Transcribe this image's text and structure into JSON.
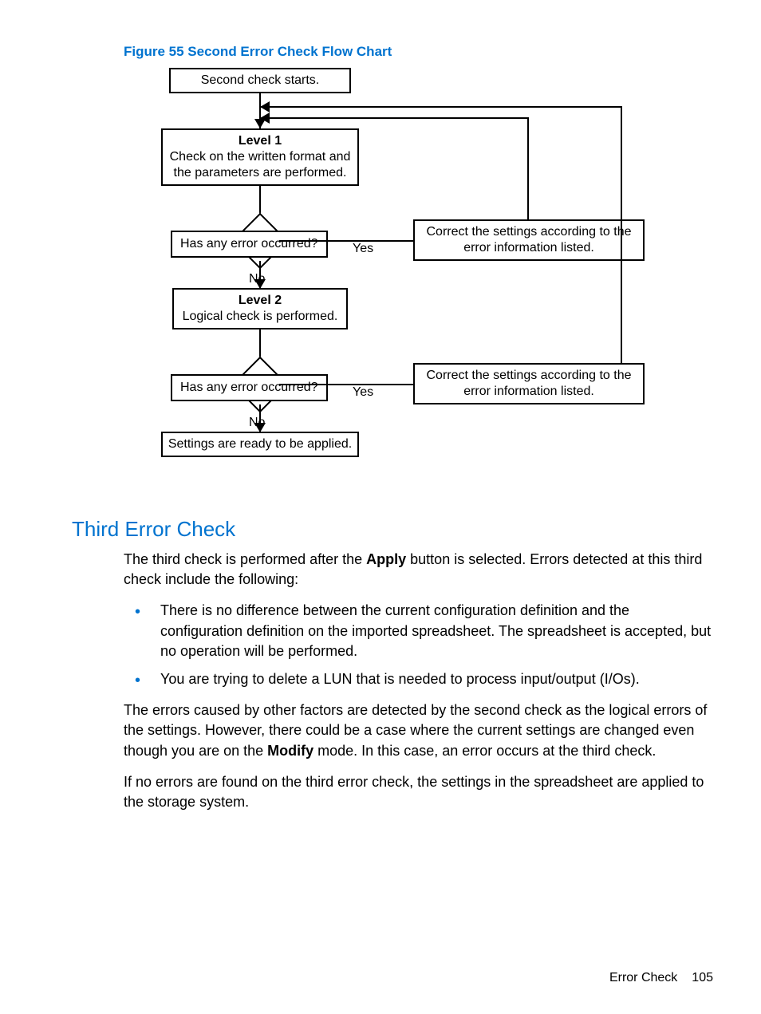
{
  "caption": "Figure 55 Second Error Check Flow Chart",
  "flow": {
    "start": "Second check starts.",
    "level1_title": "Level 1",
    "level1_text": "Check on the written format and the parameters are performed.",
    "decision1": "Has any error occurred?",
    "correct1": "Correct the settings according to the error information listed.",
    "yes": "Yes",
    "no": "No",
    "level2_title": "Level 2",
    "level2_text": "Logical check is performed.",
    "decision2": "Has any error occurred?",
    "correct2": "Correct the settings according to the error information listed.",
    "final": "Settings are ready to be applied."
  },
  "heading": "Third Error Check",
  "para1_a": "The third check is performed after the ",
  "para1_bold": "Apply",
  "para1_b": " button is selected. Errors detected at this third check include the following:",
  "bullets": [
    "There is no difference between the current configuration definition and the configuration definition on the imported spreadsheet. The spreadsheet is accepted, but no operation will be performed.",
    "You are trying to delete a LUN that is needed to process input/output (I/Os)."
  ],
  "para2_a": "The errors caused by other factors are detected by the second check as the logical errors of the settings. However, there could be a case where the current settings are changed even though you are on the ",
  "para2_bold": "Modify",
  "para2_b": " mode. In this case, an error occurs at the third check.",
  "para3": "If no errors are found on the third error check, the settings in the spreadsheet are applied to the storage system.",
  "footer_section": "Error Check",
  "footer_page": "105"
}
